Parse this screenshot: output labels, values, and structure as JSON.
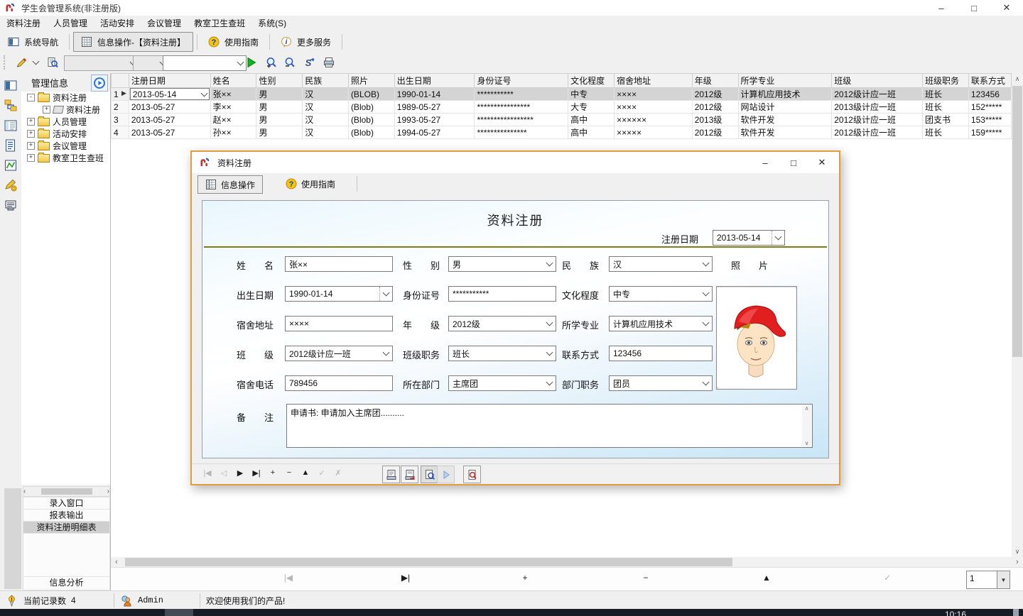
{
  "titlebar": {
    "title": "学生会管理系统(非注册版)"
  },
  "icons": {
    "minimize": "–",
    "maximize": "□",
    "close": "✕",
    "chevron_left": "‹",
    "chevron_right": "›",
    "chevron_up": "∧",
    "chevron_down": "∨",
    "dropdown": "▼",
    "row_indicator": "▶",
    "help": "?",
    "info": "i"
  },
  "menubar": {
    "items": [
      "资料注册",
      "人员管理",
      "活动安排",
      "会议管理",
      "教室卫生查班",
      "系统(S)"
    ]
  },
  "toolbar": {
    "nav": "系统导航",
    "info_op": "信息操作-【资料注册】",
    "guide": "使用指南",
    "more": "更多服务"
  },
  "searchbar": {
    "combo1": "",
    "combo2": "",
    "combo3": ""
  },
  "sidebar": {
    "header": "管理信息",
    "tree": [
      {
        "toggle": "-",
        "label": "资料注册"
      },
      {
        "toggle": "+",
        "label": "资料注册"
      },
      {
        "toggle": "+",
        "label": "人员管理"
      },
      {
        "toggle": "+",
        "label": "活动安排"
      },
      {
        "toggle": "+",
        "label": "会议管理"
      },
      {
        "toggle": "+",
        "label": "教室卫生查班"
      }
    ],
    "list": [
      "录入窗口",
      "报表输出",
      "资料注册明细表",
      "信息分析"
    ]
  },
  "grid": {
    "columns": [
      "注册日期",
      "姓名",
      "性别",
      "民族",
      "照片",
      "出生日期",
      "身份证号",
      "文化程度",
      "宿舍地址",
      "年级",
      "所学专业",
      "班级",
      "班级职务",
      "联系方式"
    ],
    "rows": [
      {
        "num": "1",
        "cells": [
          "2013-05-14",
          "张××",
          "男",
          "汉",
          "(BLOB)",
          "1990-01-14",
          "***********",
          "中专",
          "××××",
          "2012级",
          "计算机应用技术",
          "2012级计应一班",
          "班长",
          "123456"
        ]
      },
      {
        "num": "2",
        "cells": [
          "2013-05-27",
          "李××",
          "男",
          "汉",
          "(Blob)",
          "1989-05-27",
          "****************",
          "大专",
          "××××",
          "2012级",
          "网站设计",
          "2013级计应一班",
          "班长",
          "152*****"
        ]
      },
      {
        "num": "3",
        "cells": [
          "2013-05-27",
          "赵××",
          "男",
          "汉",
          "(Blob)",
          "1993-05-27",
          "*****************",
          "高中",
          "××××××",
          "2013级",
          "软件开发",
          "2012级计应一班",
          "团支书",
          "153*****"
        ]
      },
      {
        "num": "4",
        "cells": [
          "2013-05-27",
          "孙××",
          "男",
          "汉",
          "(Blob)",
          "1994-05-27",
          "***************",
          "高中",
          "×××××",
          "2012级",
          "软件开发",
          "2012级计应一班",
          "班长",
          "159*****"
        ]
      }
    ]
  },
  "dialog": {
    "title": "资料注册",
    "tabs": [
      "信息操作",
      "使用指南"
    ],
    "form_title": "资料注册",
    "reg_date_label": "注册日期",
    "reg_date": "2013-05-14",
    "photo_label": "照　　片",
    "fields": [
      {
        "label": "姓　　名",
        "value": "张××"
      },
      {
        "label": "性　　别",
        "value": "男"
      },
      {
        "label": "民　　族",
        "value": "汉"
      },
      {
        "label": "出生日期",
        "value": "1990-01-14"
      },
      {
        "label": "身份证号",
        "value": "***********"
      },
      {
        "label": "文化程度",
        "value": "中专"
      },
      {
        "label": "宿舍地址",
        "value": "××××"
      },
      {
        "label": "年　　级",
        "value": "2012级"
      },
      {
        "label": "所学专业",
        "value": "计算机应用技术"
      },
      {
        "label": "班　　级",
        "value": "2012级计应一班"
      },
      {
        "label": "班级职务",
        "value": "班长"
      },
      {
        "label": "联系方式",
        "value": "123456"
      },
      {
        "label": "宿舍电话",
        "value": "789456"
      },
      {
        "label": "所在部门",
        "value": "主席团"
      },
      {
        "label": "部门职务",
        "value": "团员"
      }
    ],
    "remark_label": "备　　注",
    "remark": "申请书: 申请加入主席团..........",
    "nav": [
      {
        "g": "|◀"
      },
      {
        "g": "◁"
      },
      {
        "g": "▶"
      },
      {
        "g": "▶|"
      },
      {
        "g": "+"
      },
      {
        "g": "−"
      },
      {
        "g": "▲"
      },
      {
        "g": "✓"
      },
      {
        "g": "✗"
      }
    ]
  },
  "bottom": {
    "nav": [
      {
        "g": "|◀"
      },
      {
        "g": "▶|"
      },
      {
        "g": "+"
      },
      {
        "g": "−"
      },
      {
        "g": "▲"
      },
      {
        "g": "✓"
      },
      {
        "g": "✗"
      }
    ],
    "page_value": "1"
  },
  "statusbar": {
    "record_label": "当前记录数",
    "record_count": "4",
    "user": "Admin",
    "welcome": "欢迎使用我们的产品!"
  },
  "taskbar": {
    "clock": "10:16"
  }
}
